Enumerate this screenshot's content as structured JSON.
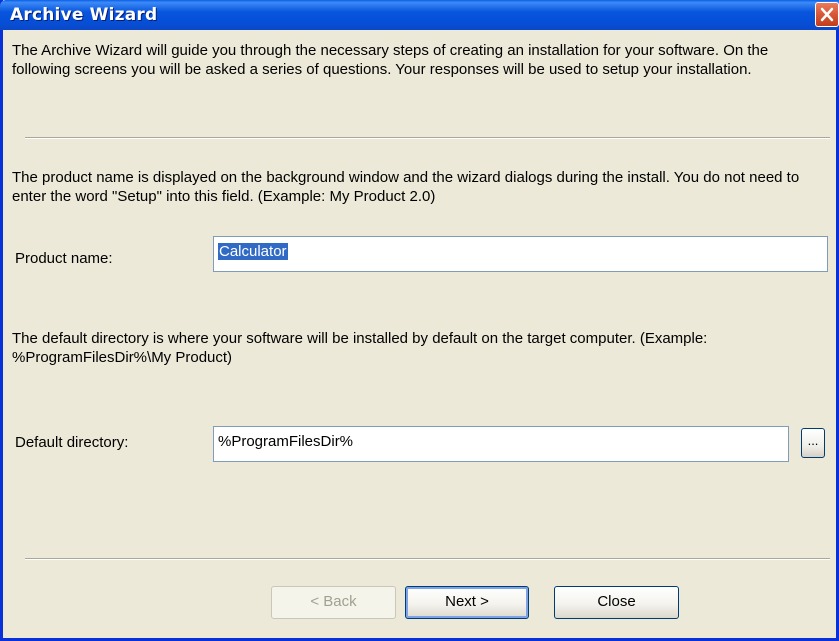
{
  "window": {
    "title": "Archive Wizard",
    "close_label": "×"
  },
  "intro": {
    "text": "The Archive Wizard will guide you through the necessary steps of creating an installation for your software. On the following screens you will be asked a series of questions. Your responses will be used to setup your installation."
  },
  "product": {
    "description": "The product name is displayed on the background window and the wizard dialogs during the install. You do not need to enter the word \"Setup\" into this field. (Example: My Product 2.0)",
    "label": "Product name:",
    "value": "Calculator"
  },
  "directory": {
    "description": "The default directory is where your software will be installed by default on the target computer. (Example: %ProgramFilesDir%\\My Product)",
    "label": "Default directory:",
    "value": "%ProgramFilesDir%",
    "browse_label": "..."
  },
  "buttons": {
    "back": "< Back",
    "next": "Next >",
    "close": "Close"
  },
  "colors": {
    "titlebar": "#0855dd",
    "close_button": "#d85b3a",
    "dialog_background": "#ece9d8",
    "selection": "#316ac5"
  }
}
